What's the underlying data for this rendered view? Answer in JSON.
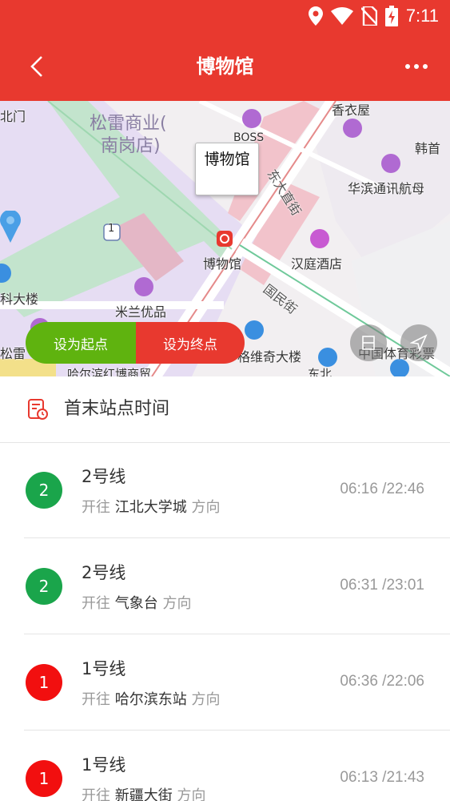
{
  "status_bar": {
    "time": "7:11"
  },
  "header": {
    "title": "博物馆"
  },
  "map": {
    "callout_label": "博物馆",
    "station_label": "博物馆",
    "labels": {
      "north_gate": "北门",
      "songlei": "松雷商业(",
      "nangang": "南岗店)",
      "boss": "BOSS",
      "xiangyiwu": "香衣屋",
      "hanshou": "韩首",
      "dongdazhijie": "东大直街",
      "huabin": "华滨通讯航母",
      "route_1": "1",
      "hanting": "汉庭酒店",
      "guominjie": "国民街",
      "keji": "科大楼",
      "milan": "米兰优品",
      "gewei": "格维奇大楼",
      "lottery": "中国体育彩票",
      "songlei_left": "松雷",
      "haerbin_bottom": "哈尔滨红博商贸",
      "dongbei": "东北"
    },
    "buttons": {
      "set_start": "设为起点",
      "set_end": "设为终点"
    }
  },
  "section": {
    "title": "首末站点时间"
  },
  "direction_prefix": "开往",
  "direction_suffix": "方向",
  "lines": [
    {
      "badge": "2",
      "color": "#1aa54b",
      "name": "2号线",
      "destination": "江北大学城",
      "times": "06:16 /22:46"
    },
    {
      "badge": "2",
      "color": "#1aa54b",
      "name": "2号线",
      "destination": "气象台",
      "times": "06:31 /23:01"
    },
    {
      "badge": "1",
      "color": "#f20f0f",
      "name": "1号线",
      "destination": "哈尔滨东站",
      "times": "06:36 /22:06"
    },
    {
      "badge": "1",
      "color": "#f20f0f",
      "name": "1号线",
      "destination": "新疆大街",
      "times": "06:13 /21:43"
    }
  ],
  "colors": {
    "brand": "#e8392f",
    "start_button": "#5fb30f",
    "line2": "#1aa54b",
    "line1": "#f20f0f"
  },
  "icons": [
    "location-icon",
    "wifi-icon",
    "no-sim-icon",
    "battery-charging-icon",
    "back-arrow-icon",
    "more-icon",
    "schedule-icon",
    "metro-station-icon"
  ]
}
